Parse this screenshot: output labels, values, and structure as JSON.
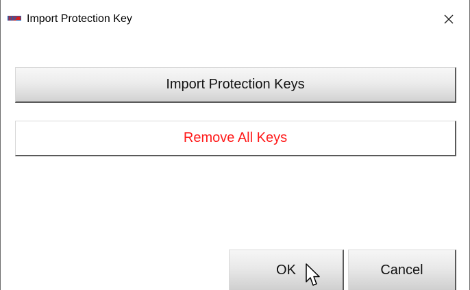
{
  "window": {
    "title": "Import Protection Key",
    "app_icon": "rs-logo-icon",
    "close_icon": "close-icon"
  },
  "buttons": {
    "import_label": "Import Protection Keys",
    "remove_label": "Remove All Keys",
    "ok_label": "OK",
    "cancel_label": "Cancel"
  },
  "colors": {
    "remove_text": "#ff1a1a",
    "button_border_dark": "#5a5a5a",
    "app_icon_red": "#d32020",
    "app_icon_blue": "#1d5fb3"
  },
  "cursor": "arrow-cursor-icon"
}
